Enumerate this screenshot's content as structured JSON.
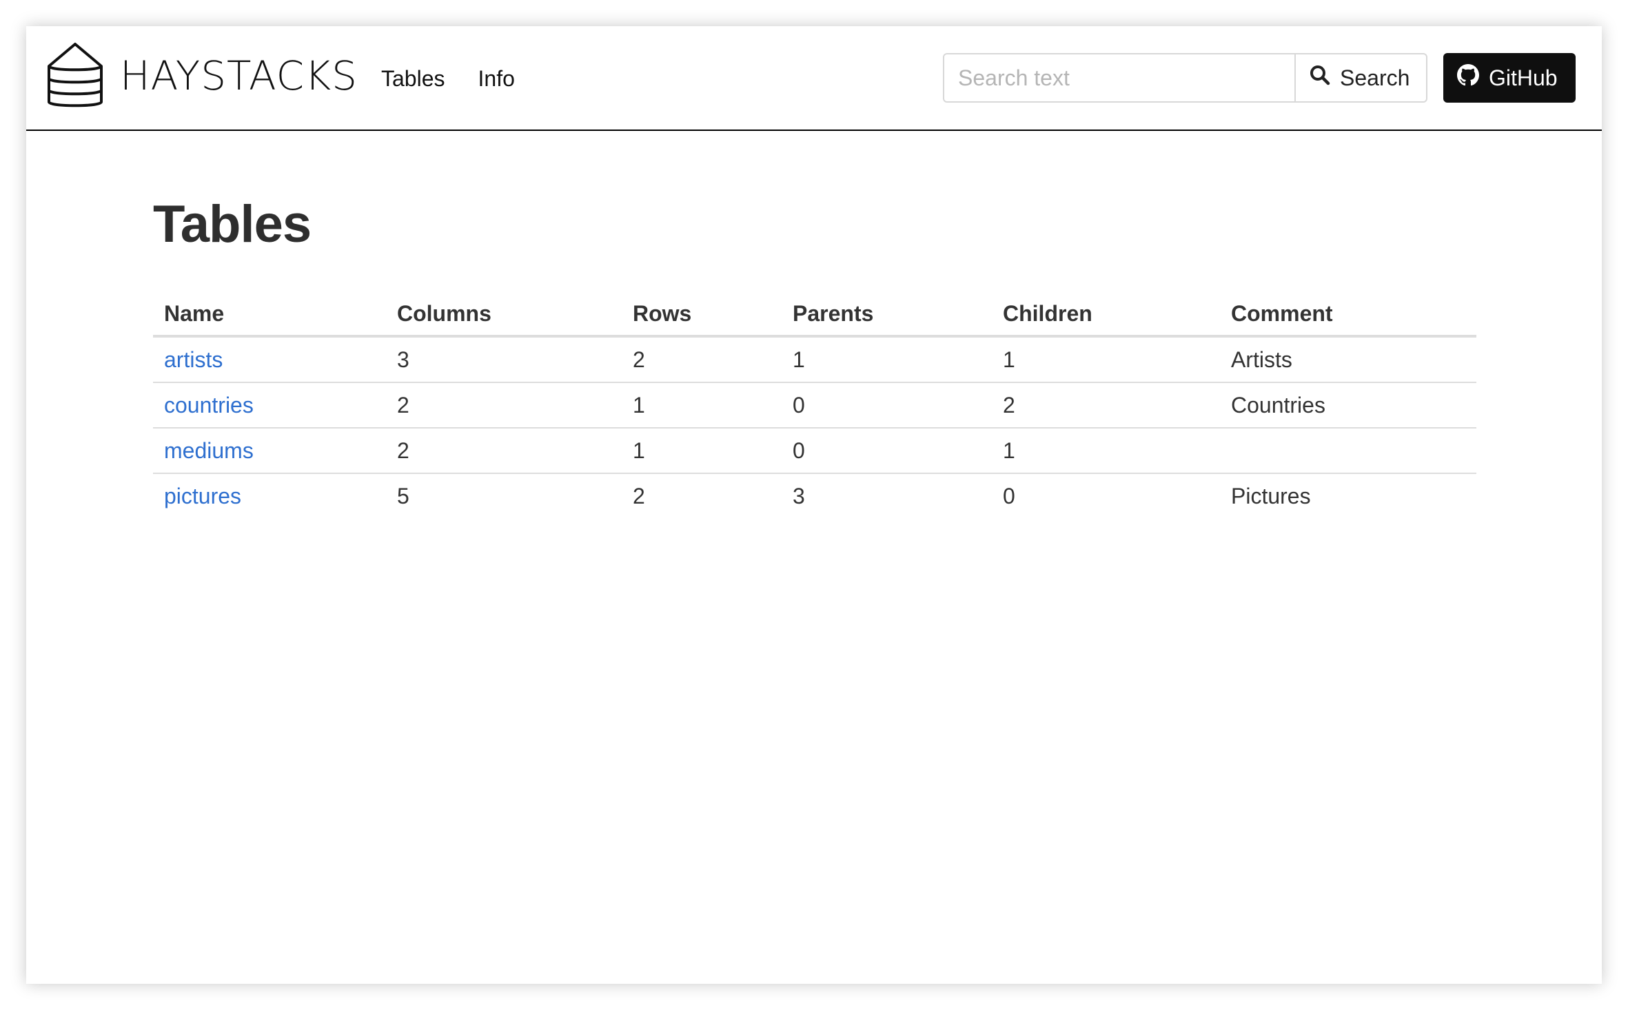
{
  "brand": {
    "name": "HAYSTACKS",
    "icon": "haystack-logo-icon"
  },
  "nav": {
    "items": [
      {
        "label": "Tables"
      },
      {
        "label": "Info"
      }
    ]
  },
  "search": {
    "placeholder": "Search text",
    "value": "",
    "button_label": "Search",
    "icon": "search-icon"
  },
  "github": {
    "label": "GitHub",
    "icon": "github-icon",
    "background": "#0f0f0f"
  },
  "page": {
    "title": "Tables"
  },
  "table": {
    "headers": [
      "Name",
      "Columns",
      "Rows",
      "Parents",
      "Children",
      "Comment"
    ],
    "rows": [
      {
        "name": "artists",
        "columns": "3",
        "rows": "2",
        "parents": "1",
        "children": "1",
        "comment": "Artists"
      },
      {
        "name": "countries",
        "columns": "2",
        "rows": "1",
        "parents": "0",
        "children": "2",
        "comment": "Countries"
      },
      {
        "name": "mediums",
        "columns": "2",
        "rows": "1",
        "parents": "0",
        "children": "1",
        "comment": ""
      },
      {
        "name": "pictures",
        "columns": "5",
        "rows": "2",
        "parents": "3",
        "children": "0",
        "comment": "Pictures"
      }
    ]
  },
  "colors": {
    "link": "#2e6fcf",
    "text": "#333333",
    "navbar_border": "#000000"
  }
}
